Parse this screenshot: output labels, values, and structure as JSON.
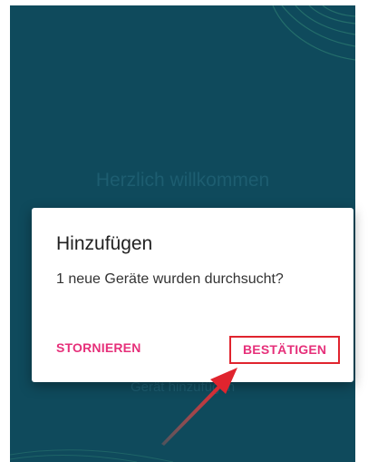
{
  "screen": {
    "welcome_text": "Herzlich willkommen",
    "below_button_text": "Gerät hinzufügen"
  },
  "dialog": {
    "title": "Hinzufügen",
    "message": "1 neue Geräte wurden durchsucht?",
    "cancel_label": "STORNIEREN",
    "confirm_label": "BESTÄTIGEN"
  },
  "colors": {
    "background": "#0f4a5c",
    "accent": "#e6307a",
    "highlight": "#e0242e"
  }
}
